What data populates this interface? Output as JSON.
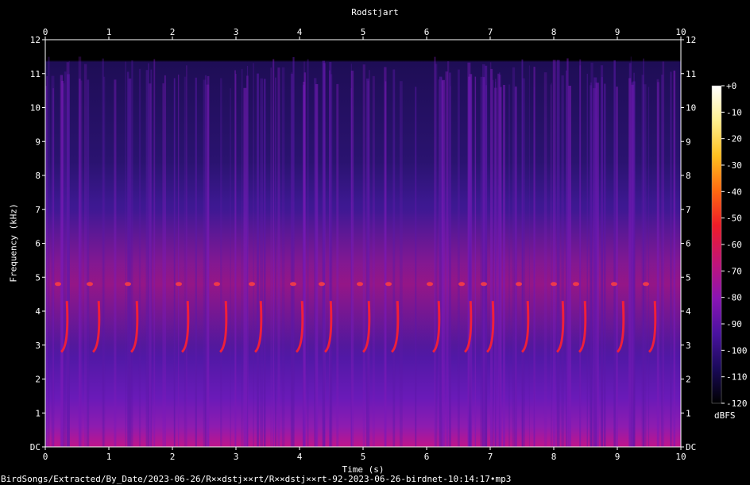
{
  "chart_data": {
    "type": "heatmap",
    "title": "Rodstjart",
    "xlabel": "Time (s)",
    "ylabel": "Frequency (kHz)",
    "xlim": [
      0,
      10
    ],
    "ylim": [
      0,
      12
    ],
    "x_ticks": [
      0,
      1,
      2,
      3,
      4,
      5,
      6,
      7,
      8,
      9,
      10
    ],
    "y_ticks": [
      "DC",
      "1",
      "2",
      "3",
      "4",
      "5",
      "6",
      "7",
      "8",
      "9",
      "10",
      "11",
      "12"
    ],
    "colorbar": {
      "label": "dBFS",
      "range": [
        -120,
        0
      ],
      "ticks": [
        "+0",
        "-10",
        "-20",
        "-30",
        "-40",
        "-50",
        "-60",
        "-70",
        "-80",
        "-90",
        "-100",
        "-110",
        "-120"
      ],
      "colors": [
        "#000000",
        "#1a0a5a",
        "#4a12a0",
        "#8a14b4",
        "#c0147a",
        "#ee1c28",
        "#ff6a10",
        "#ffc020",
        "#fff090",
        "#ffffff"
      ]
    },
    "signal_top_khz": 11.5,
    "calls": {
      "start_times_s": [
        0.25,
        0.75,
        1.35,
        2.15,
        2.75,
        3.3,
        3.95,
        4.4,
        5.0,
        5.45,
        6.1,
        6.6,
        6.95,
        7.5,
        8.05,
        8.4,
        9.0,
        9.5
      ],
      "high_note_khz": 4.8,
      "sweep_from_khz": 2.8,
      "sweep_to_khz": 4.3
    }
  },
  "footer": {
    "file_path": "BirdSongs/Extracted/By_Date/2023-06-26/R××dstj××rt/R××dstj××rt-92-2023-06-26-birdnet-10:14:17•mp3"
  }
}
